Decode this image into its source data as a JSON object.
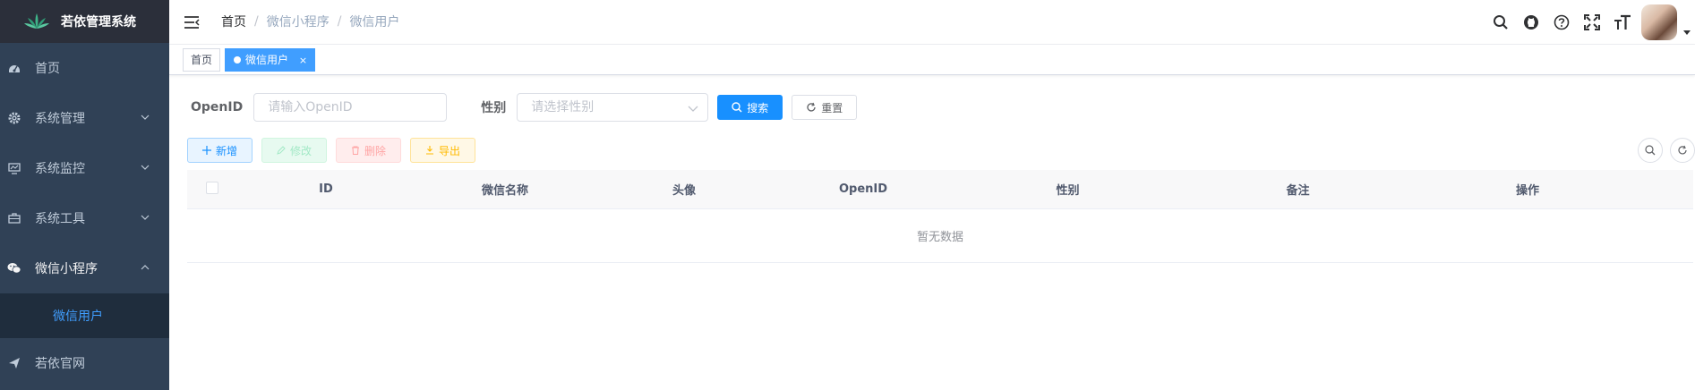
{
  "app": {
    "title": "若依管理系统"
  },
  "sidebar": {
    "items": [
      {
        "label": "首页",
        "icon": "dashboard-icon"
      },
      {
        "label": "系统管理",
        "icon": "gear-icon",
        "has_children": true
      },
      {
        "label": "系统监控",
        "icon": "monitor-icon",
        "has_children": true
      },
      {
        "label": "系统工具",
        "icon": "toolbox-icon",
        "has_children": true
      },
      {
        "label": "微信小程序",
        "icon": "wechat-icon",
        "has_children": true,
        "expanded": true
      },
      {
        "label": "若依官网",
        "icon": "send-icon"
      }
    ],
    "submenu": [
      {
        "label": "微信用户",
        "active": true
      }
    ]
  },
  "breadcrumb": [
    "首页",
    "微信小程序",
    "微信用户"
  ],
  "header": {
    "icons": [
      "search-icon",
      "github-icon",
      "help-icon",
      "fullscreen-icon",
      "font-size-icon"
    ]
  },
  "tags": [
    {
      "label": "首页",
      "active": false
    },
    {
      "label": "微信用户",
      "active": true,
      "close": "×"
    }
  ],
  "search_form": {
    "openid_label": "OpenID",
    "openid_placeholder": "请输入OpenID",
    "gender_label": "性别",
    "gender_placeholder": "请选择性别",
    "search_label": "搜索",
    "reset_label": "重置"
  },
  "toolbar": {
    "add_label": "新增",
    "edit_label": "修改",
    "delete_label": "删除",
    "export_label": "导出"
  },
  "table": {
    "columns": [
      "ID",
      "微信名称",
      "头像",
      "OpenID",
      "性别",
      "备注",
      "操作"
    ],
    "empty_text": "暂无数据"
  },
  "colors": {
    "sidebar_bg": "#304156",
    "primary": "#1890ff",
    "active_text": "#409eff"
  }
}
